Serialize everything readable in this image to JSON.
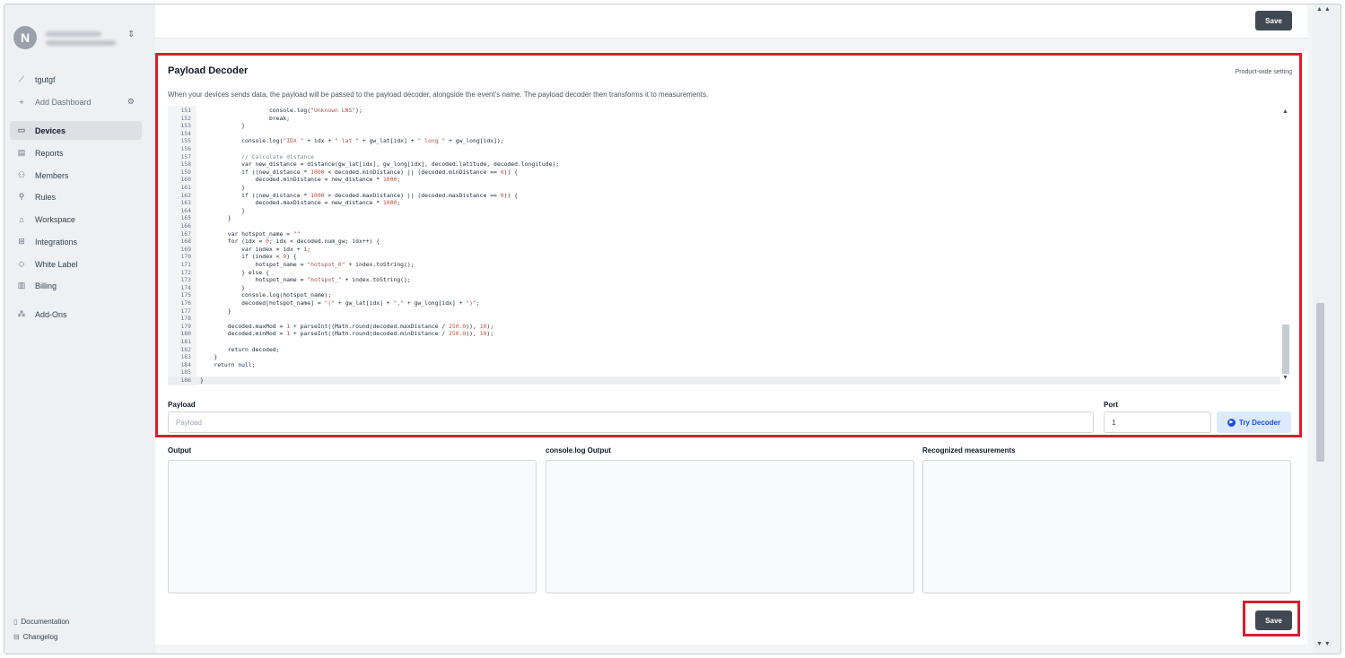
{
  "sidebar": {
    "avatar_initial": "N",
    "items": [
      {
        "label": "tgutgf",
        "icon": "chart-icon"
      },
      {
        "label": "Add Dashboard",
        "icon": "plus-icon"
      },
      {
        "label": "Devices",
        "icon": "devices-icon"
      },
      {
        "label": "Reports",
        "icon": "report-icon"
      },
      {
        "label": "Members",
        "icon": "members-icon"
      },
      {
        "label": "Rules",
        "icon": "rules-icon"
      },
      {
        "label": "Workspace",
        "icon": "workspace-icon"
      },
      {
        "label": "Integrations",
        "icon": "integrations-icon"
      },
      {
        "label": "White Label",
        "icon": "tag-icon"
      },
      {
        "label": "Billing",
        "icon": "billing-icon"
      },
      {
        "label": "Add-Ons",
        "icon": "addons-icon"
      }
    ],
    "documentation": "Documentation",
    "changelog": "Changelog"
  },
  "top_save_label": "Save",
  "decoder": {
    "title": "Payload Decoder",
    "scope": "Product-wide setting",
    "description": "When your devices sends data, the payload will be passed to the payload decoder, alongside the event's name. The payload decoder then transforms it to measurements.",
    "code_lines": [
      {
        "n": "151",
        "t": "                    console.log(\"Unknown LNS\");"
      },
      {
        "n": "152",
        "t": "                    break;"
      },
      {
        "n": "153",
        "t": "            }"
      },
      {
        "n": "154",
        "t": ""
      },
      {
        "n": "155",
        "t": "            console.log(\"IDX \" + idx + \" lat \" + gw_lat[idx] + \" long \" + gw_long[idx]);"
      },
      {
        "n": "156",
        "t": ""
      },
      {
        "n": "157",
        "t": "            // Calculate distance"
      },
      {
        "n": "158",
        "t": "            var new_distance = distance(gw_lat[idx], gw_long[idx], decoded.latitude, decoded.longitude);"
      },
      {
        "n": "159",
        "t": "            if ((new_distance * 1000 < decoded.minDistance) || (decoded.minDistance == 0)) {"
      },
      {
        "n": "160",
        "t": "                decoded.minDistance = new_distance * 1000;"
      },
      {
        "n": "161",
        "t": "            }"
      },
      {
        "n": "162",
        "t": "            if ((new_distance * 1000 > decoded.maxDistance) || (decoded.maxDistance == 0)) {"
      },
      {
        "n": "163",
        "t": "                decoded.maxDistance = new_distance * 1000;"
      },
      {
        "n": "164",
        "t": "            }"
      },
      {
        "n": "165",
        "t": "        }"
      },
      {
        "n": "166",
        "t": ""
      },
      {
        "n": "167",
        "t": "        var hotspot_name = \"\""
      },
      {
        "n": "168",
        "t": "        for (idx = 0; idx < decoded.num_gw; idx++) {"
      },
      {
        "n": "169",
        "t": "            var index = idx + 1;"
      },
      {
        "n": "170",
        "t": "            if (index < 9) {"
      },
      {
        "n": "171",
        "t": "                hotspot_name = \"hotspot_0\" + index.toString();"
      },
      {
        "n": "172",
        "t": "            } else {"
      },
      {
        "n": "173",
        "t": "                hotspot_name = \"hotspot_\" + index.toString();"
      },
      {
        "n": "174",
        "t": "            }"
      },
      {
        "n": "175",
        "t": "            console.log(hotspot_name);"
      },
      {
        "n": "176",
        "t": "            decoded[hotspot_name] = \"(\" + gw_lat[idx] + \",\" + gw_long[idx] + \")\";"
      },
      {
        "n": "177",
        "t": "        }"
      },
      {
        "n": "178",
        "t": ""
      },
      {
        "n": "179",
        "t": "        decoded.maxMod = 1 + parseInt((Math.round(decoded.maxDistance / 250.0)), 10);"
      },
      {
        "n": "180",
        "t": "        decoded.minMod = 1 + parseInt((Math.round(decoded.minDistance / 250.0)), 10);"
      },
      {
        "n": "181",
        "t": ""
      },
      {
        "n": "182",
        "t": "        return decoded;"
      },
      {
        "n": "183",
        "t": "    }"
      },
      {
        "n": "184",
        "t": "    return null;"
      },
      {
        "n": "185",
        "t": ""
      },
      {
        "n": "186",
        "t": "}"
      }
    ],
    "payload_label": "Payload",
    "payload_placeholder": "Payload",
    "port_label": "Port",
    "port_value": "1",
    "try_label": "Try Decoder"
  },
  "outputs": {
    "output_label": "Output",
    "console_label": "console.log Output",
    "measurements_label": "Recognized measurements"
  },
  "bottom_save_label": "Save",
  "colors": {
    "highlight": "#d3202e",
    "save_button": "#404852",
    "try_button_bg": "#dbeafe"
  }
}
